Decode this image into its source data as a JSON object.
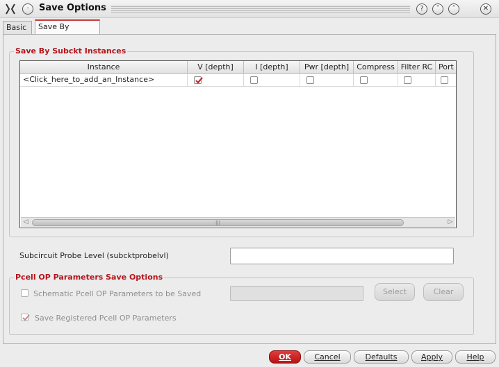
{
  "window": {
    "title": "Save Options",
    "help_glyph": "?",
    "minimize_glyph": "˅",
    "maximize_glyph": "˄",
    "close_glyph": "✕",
    "menu_glyph": "·"
  },
  "tabs": [
    {
      "label": "Basic",
      "active": false
    },
    {
      "label": "Save By Subckt",
      "active": true
    }
  ],
  "instances_group": {
    "title": "Save By Subckt Instances",
    "columns": [
      "Instance",
      "V [depth]",
      "I [depth]",
      "Pwr [depth]",
      "Compress",
      "Filter RC",
      "Port"
    ],
    "rows": [
      {
        "instance": "<Click_here_to_add_an_Instance>",
        "v_depth": true,
        "i_depth": false,
        "pwr_depth": false,
        "compress": false,
        "filter_rc": false,
        "port": false
      }
    ],
    "scroll_left_glyph": "◁",
    "scroll_right_glyph": "▷",
    "scroll_grip": "|||"
  },
  "probe_level": {
    "label": "Subcircuit Probe Level (subcktprobelvl)",
    "value": ""
  },
  "pcell_group": {
    "title": "Pcell OP Parameters Save Options",
    "schematic_label": "Schematic Pcell OP Parameters to be Saved",
    "schematic_checked": false,
    "schematic_value": "",
    "select_label": "Select",
    "clear_label": "Clear",
    "registered_label": "Save Registered Pcell OP Parameters",
    "registered_checked": true
  },
  "buttons": {
    "ok": "OK",
    "cancel": "Cancel",
    "defaults": "Defaults",
    "apply": "Apply",
    "help": "Help"
  },
  "colors": {
    "accent": "#b3141b",
    "check": "#c0282c"
  }
}
